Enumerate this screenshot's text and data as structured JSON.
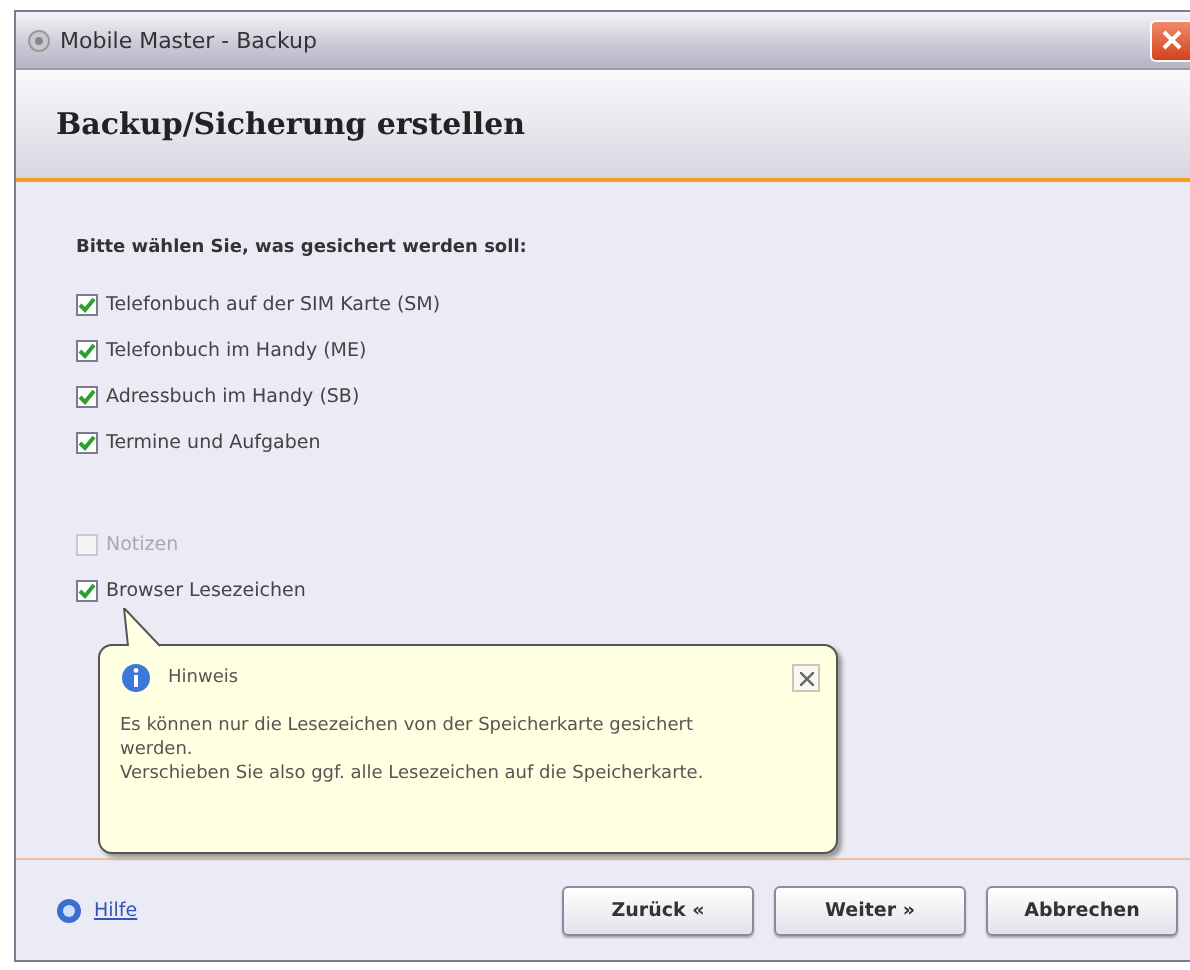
{
  "window": {
    "title": "Mobile Master - Backup"
  },
  "header": {
    "title": "Backup/Sicherung erstellen"
  },
  "prompt": "Bitte wählen Sie, was gesichert werden soll:",
  "option_groups": [
    [
      {
        "label": "Telefonbuch auf der SIM Karte (SM)",
        "checked": true,
        "disabled": false
      },
      {
        "label": "Telefonbuch im Handy (ME)",
        "checked": true,
        "disabled": false
      },
      {
        "label": "Adressbuch im Handy (SB)",
        "checked": true,
        "disabled": false
      },
      {
        "label": "Termine und Aufgaben",
        "checked": true,
        "disabled": false
      }
    ],
    [
      {
        "label": "Notizen",
        "checked": false,
        "disabled": true
      },
      {
        "label": "Browser Lesezeichen",
        "checked": true,
        "disabled": false
      }
    ]
  ],
  "tooltip": {
    "title": "Hinweis",
    "lines": [
      "Es können nur die Lesezeichen von der Speicherkarte gesichert werden.",
      "Verschieben Sie also ggf. alle Lesezeichen auf die Speicherkarte."
    ]
  },
  "help_link": "Hilfe",
  "buttons": [
    "Zurück «",
    "Weiter »",
    "Abbrechen"
  ]
}
